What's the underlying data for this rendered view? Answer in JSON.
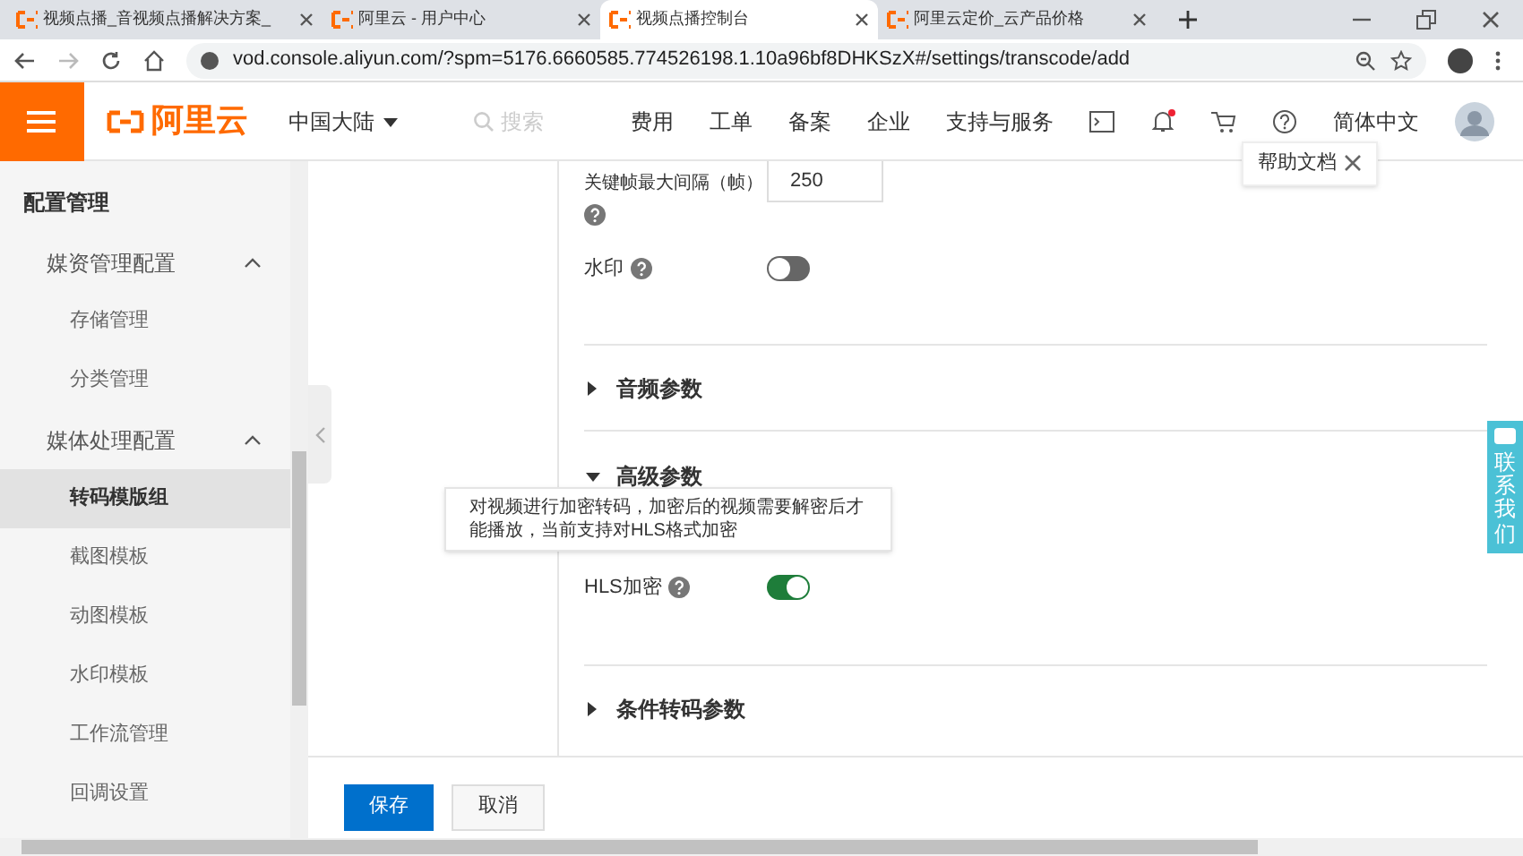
{
  "browser": {
    "tabs": [
      {
        "title": "视频点播_音视频点播解决方案_",
        "selected": false
      },
      {
        "title": "阿里云 - 用户中心",
        "selected": false
      },
      {
        "title": "视频点播控制台",
        "selected": true
      },
      {
        "title": "阿里云定价_云产品价格",
        "selected": false
      }
    ],
    "url": "vod.console.aliyun.com/?spm=5176.6660585.774526198.1.10a96bf8DHKSzX#/settings/transcode/add"
  },
  "header": {
    "logo": "阿里云",
    "region": "中国大陆",
    "search_placeholder": "搜索",
    "nav": [
      "费用",
      "工单",
      "备案",
      "企业",
      "支持与服务"
    ],
    "has_notification": true,
    "language": "简体中文",
    "help_popup": "帮助文档"
  },
  "sidebar": {
    "title": "配置管理",
    "groups": [
      {
        "label": "媒资管理配置",
        "expanded": true,
        "children": [
          {
            "label": "存储管理",
            "selected": false
          },
          {
            "label": "分类管理",
            "selected": false
          }
        ]
      },
      {
        "label": "媒体处理配置",
        "expanded": true,
        "children": [
          {
            "label": "转码模版组",
            "selected": true
          },
          {
            "label": "截图模板",
            "selected": false
          },
          {
            "label": "动图模板",
            "selected": false
          },
          {
            "label": "水印模板",
            "selected": false
          },
          {
            "label": "工作流管理",
            "selected": false
          },
          {
            "label": "回调设置",
            "selected": false
          }
        ]
      }
    ]
  },
  "form": {
    "items": [
      {
        "kind": "number",
        "label": "关键帧最大间隔（帧）",
        "value": "250"
      },
      {
        "kind": "toggle",
        "label": "水印",
        "on": false
      },
      {
        "kind": "section",
        "label": "音频参数",
        "expanded": false
      },
      {
        "kind": "section",
        "label": "高级参数",
        "expanded": true
      },
      {
        "kind": "toggle",
        "label": "HLS加密",
        "on": true,
        "tooltip": "对视频进行加密转码，加密后的视频需要解密后才能播放，当前支持对HLS格式加密"
      },
      {
        "kind": "section",
        "label": "条件转码参数",
        "expanded": false
      }
    ],
    "buttons": [
      {
        "label": "保存",
        "primary": true
      },
      {
        "label": "取消",
        "primary": false
      }
    ]
  },
  "contact": "联系我们"
}
